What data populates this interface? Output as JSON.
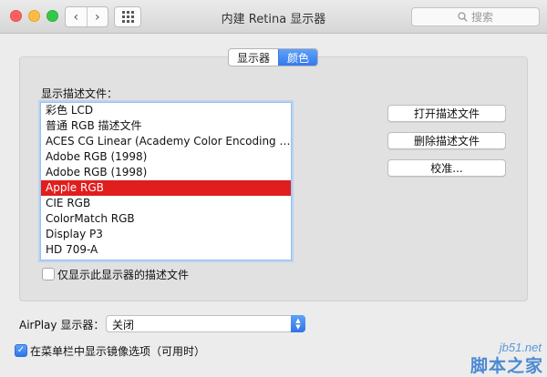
{
  "window": {
    "title": "内建 Retina 显示器"
  },
  "toolbar": {
    "back_glyph": "‹",
    "forward_glyph": "›",
    "search_placeholder": "搜索"
  },
  "tabs": [
    {
      "label": "显示器",
      "active": false
    },
    {
      "label": "颜色",
      "active": true
    }
  ],
  "profiles": {
    "label": "显示描述文件：",
    "items": [
      "彩色 LCD",
      "普通 RGB 描述文件",
      "ACES CG Linear (Academy Color Encoding Sy...",
      "Adobe RGB (1998)",
      "Adobe RGB (1998)",
      "Apple RGB",
      "CIE RGB",
      "ColorMatch RGB",
      "Display P3",
      "HD 709-A"
    ],
    "selected_index": 5,
    "show_only_label": "仅显示此显示器的描述文件",
    "show_only_checked": false
  },
  "buttons": {
    "open": "打开描述文件",
    "delete": "删除描述文件",
    "calibrate": "校准..."
  },
  "airplay": {
    "label": "AirPlay 显示器：",
    "value": "关闭"
  },
  "mirroring": {
    "label": "在菜单栏中显示镜像选项（可用时）",
    "checked": true
  },
  "watermark": {
    "site": "jb51.net",
    "brand": "脚本之家"
  },
  "colors": {
    "selection": "#e01e1e",
    "accent": "#3479ee"
  }
}
